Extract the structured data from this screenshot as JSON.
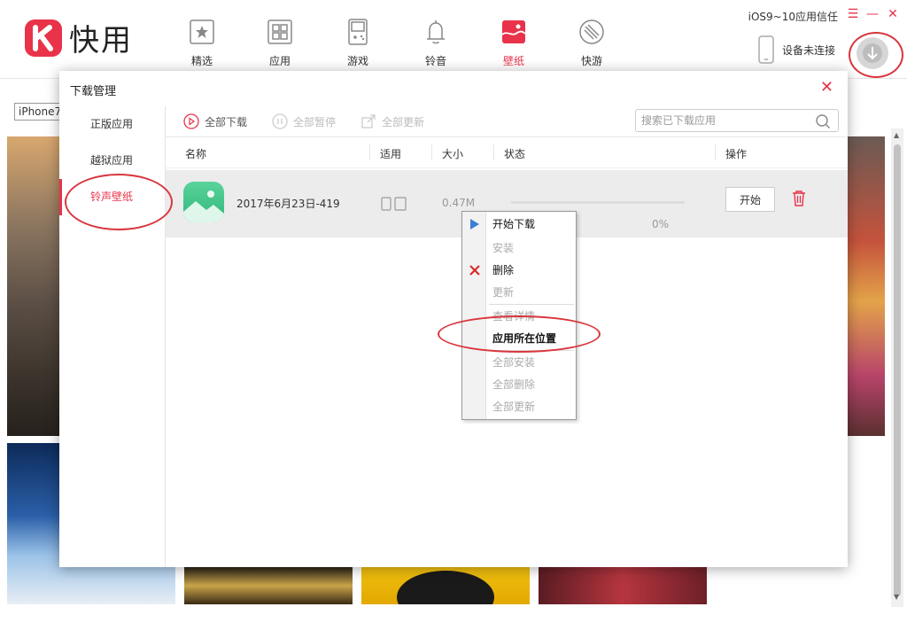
{
  "app": {
    "name": "快用",
    "window_title": "iOS9~10应用信任"
  },
  "nav": [
    {
      "label": "精选",
      "icon": "star-icon"
    },
    {
      "label": "应用",
      "icon": "grid-icon"
    },
    {
      "label": "游戏",
      "icon": "gamepad-icon"
    },
    {
      "label": "铃音",
      "icon": "bell-icon"
    },
    {
      "label": "壁纸",
      "icon": "wallpaper-icon",
      "active": true
    },
    {
      "label": "快游",
      "icon": "rocket-icon"
    }
  ],
  "device": {
    "status": "设备未连接"
  },
  "background": {
    "search_text": "iPhone7"
  },
  "dialog": {
    "title": "下载管理",
    "sidebar": [
      {
        "label": "正版应用"
      },
      {
        "label": "越狱应用"
      },
      {
        "label": "铃声壁纸",
        "active": true
      }
    ],
    "toolbar": {
      "start_all": "全部下载",
      "pause_all": "全部暂停",
      "update_all": "全部更新",
      "search_placeholder": "搜索已下载应用"
    },
    "columns": {
      "name": "名称",
      "compat": "适用",
      "size": "大小",
      "status": "状态",
      "action": "操作"
    },
    "rows": [
      {
        "name": "2017年6月23日-419",
        "size": "0.47M",
        "progress_percent": 0,
        "progress_text": "0%",
        "action_label": "开始"
      }
    ]
  },
  "context_menu": {
    "items": [
      {
        "label": "开始下载",
        "enabled": true,
        "icon": "play-icon"
      },
      {
        "label": "安装",
        "enabled": false
      },
      {
        "label": "删除",
        "enabled": true,
        "icon": "delete-x-icon"
      },
      {
        "label": "更新",
        "enabled": false
      },
      {
        "label": "查看详情",
        "enabled": false
      },
      {
        "label": "应用所在位置",
        "enabled": true,
        "bold": true
      },
      {
        "label": "全部安装",
        "enabled": false
      },
      {
        "label": "全部删除",
        "enabled": false
      },
      {
        "label": "全部更新",
        "enabled": false
      }
    ]
  },
  "colors": {
    "accent": "#e8334a",
    "annotation_red": "#d9363e",
    "menu_play_blue": "#3a7fd5"
  }
}
